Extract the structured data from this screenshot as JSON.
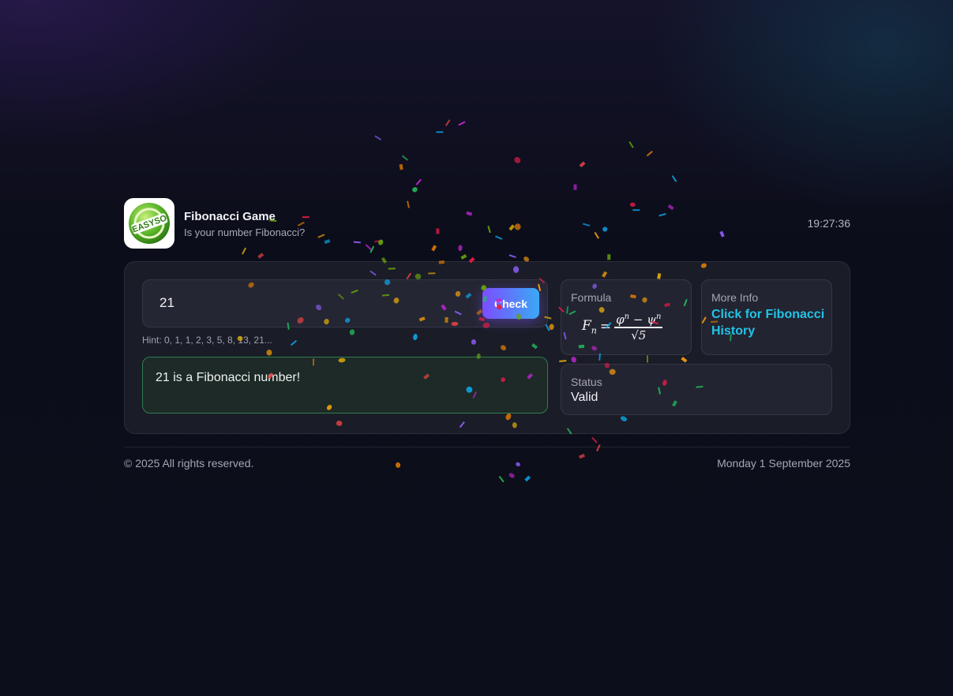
{
  "header": {
    "title": "Fibonacci Game",
    "subtitle": "Is your number Fibonacci?",
    "clock": "19:27:36",
    "logo_text": "EASYSO"
  },
  "main": {
    "input_value": "21",
    "check_label": "Check",
    "hint": "Hint: 0, 1, 1, 2, 3, 5, 8, 13, 21...",
    "result_message": "21 is a Fibonacci number!",
    "formula_label": "Formula",
    "more_info_label": "More Info",
    "more_info_link": "Click for Fibonacci History",
    "status_label": "Status",
    "status_value": "Valid"
  },
  "footer": {
    "copyright": "© 2025 All rights reserved.",
    "date": "Monday 1 September 2025"
  },
  "colors": {
    "accent_purple": "#7c4dff",
    "accent_blue": "#3aa9f5",
    "link_cyan": "#22c3e6",
    "success_border": "#2f7d4f"
  }
}
